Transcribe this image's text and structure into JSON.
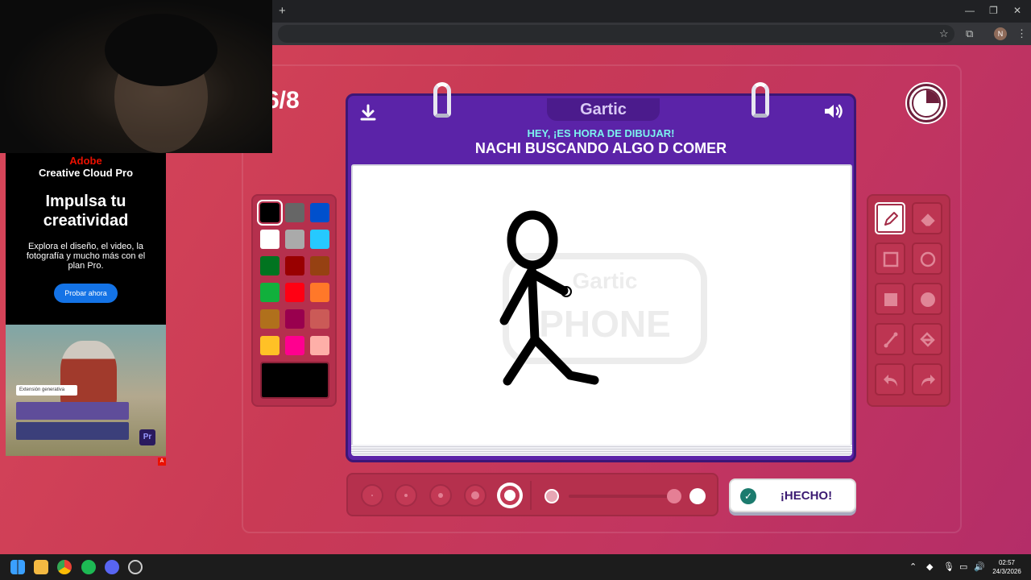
{
  "browser": {
    "new_tab": "+",
    "minimize": "—",
    "restore": "❐",
    "close": "✕",
    "profile_initial": "N"
  },
  "game": {
    "round": "6/8",
    "logo": "Gartic",
    "subtitle": "HEY, ¡ES HORA DE DIBUJAR!",
    "prompt": "NACHI BUSCANDO ALGO D COMER",
    "done_label": "¡HECHO!",
    "watermark_top": "Gartic",
    "watermark_bottom": "PHONE",
    "palette": [
      "#000000",
      "#666666",
      "#0050cd",
      "#ffffff",
      "#aaaaaa",
      "#26c9ff",
      "#017420",
      "#990000",
      "#964112",
      "#11b03c",
      "#ff0013",
      "#ff7829",
      "#b0701c",
      "#99004e",
      "#cb5a57",
      "#ffc126",
      "#ff008f",
      "#feafa8"
    ],
    "selected_color": "#000000",
    "tools": [
      "pencil-icon",
      "eraser-icon",
      "rectangle-outline-icon",
      "circle-outline-icon",
      "rectangle-fill-icon",
      "circle-fill-icon",
      "line-icon",
      "bucket-icon",
      "undo-icon",
      "redo-icon"
    ],
    "active_tool": "pencil-icon",
    "brush_sizes_selected_index": 4,
    "opacity_level": 1.0
  },
  "ad": {
    "brand": "Adobe",
    "product": "Creative Cloud Pro",
    "headline": "Impulsa tu creatividad",
    "body": "Explora el diseño, el video, la fotografía y mucho más con el plan Pro.",
    "cta": "Probar ahora",
    "chip": "Extensión generativa",
    "app_badge": "Pr",
    "ad_marker": "A"
  },
  "taskbar": {
    "time": "02:57",
    "date": "24/3/2026"
  }
}
